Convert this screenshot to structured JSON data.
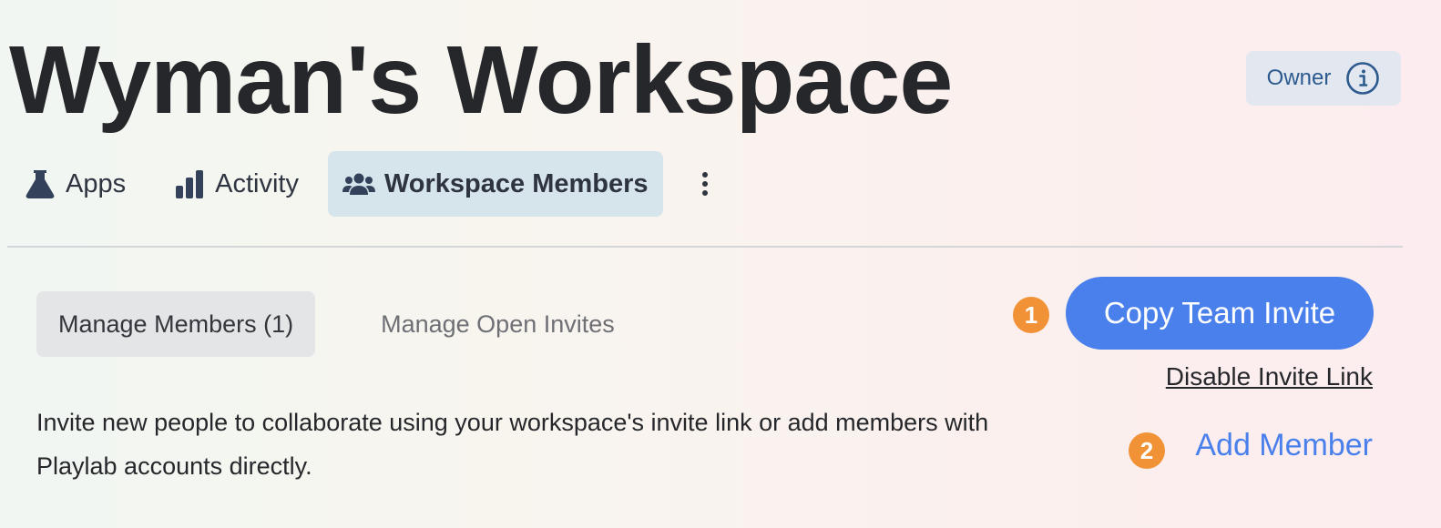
{
  "workspace": {
    "title": "Wyman's Workspace",
    "role_badge": "Owner",
    "role_icon": "info-icon"
  },
  "nav": {
    "tabs": [
      {
        "label": "Apps",
        "icon": "flask-icon",
        "active": false
      },
      {
        "label": "Activity",
        "icon": "bar-chart-icon",
        "active": false
      },
      {
        "label": "Workspace Members",
        "icon": "users-icon",
        "active": true
      }
    ],
    "more_icon": "vertical-ellipsis-icon"
  },
  "members": {
    "sub_tabs": [
      {
        "label": "Manage Members (1)",
        "active": true
      },
      {
        "label": "Manage Open Invites",
        "active": false
      }
    ],
    "description": "Invite new people to collaborate using your workspace's invite link or add members with Playlab accounts directly.",
    "copy_invite": {
      "step": "1",
      "label": "Copy Team Invite"
    },
    "disable_invite_label": "Disable Invite Link",
    "add_member": {
      "step": "2",
      "label": "Add Member"
    }
  },
  "colors": {
    "accent": "#4a80ec",
    "step_badge": "#f19237",
    "active_tab_bg": "#d6e4ec",
    "owner_badge_bg": "#e3e8f0",
    "owner_text": "#2c5a8f"
  }
}
